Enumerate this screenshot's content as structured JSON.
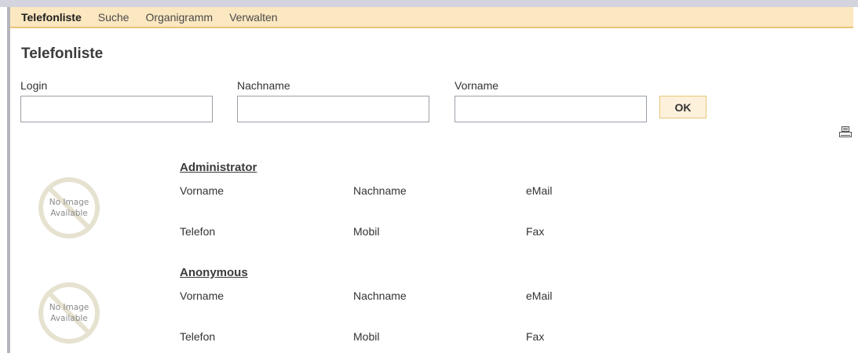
{
  "nav": {
    "items": [
      {
        "label": "Telefonliste",
        "active": true
      },
      {
        "label": "Suche",
        "active": false
      },
      {
        "label": "Organigramm",
        "active": false
      },
      {
        "label": "Verwalten",
        "active": false
      }
    ]
  },
  "page_title": "Telefonliste",
  "search": {
    "login_label": "Login",
    "login_value": "",
    "nachname_label": "Nachname",
    "nachname_value": "",
    "vorname_label": "Vorname",
    "vorname_value": "",
    "ok_label": "OK"
  },
  "icons": {
    "print": "print-icon",
    "no_image": "no-image-placeholder"
  },
  "no_image_text": [
    "No Image",
    "Available"
  ],
  "users": [
    {
      "name": "Administrator",
      "vorname": "Vorname",
      "nachname": "Nachname",
      "email": "eMail",
      "telefon": "Telefon",
      "mobil": "Mobil",
      "fax": "Fax"
    },
    {
      "name": "Anonymous",
      "vorname": "Vorname",
      "nachname": "Nachname",
      "email": "eMail",
      "telefon": "Telefon",
      "mobil": "Mobil",
      "fax": "Fax"
    }
  ],
  "colors": {
    "nav_background": "#fbe7c0",
    "nav_border": "#e9c478",
    "button_background": "#fdf1dc"
  }
}
